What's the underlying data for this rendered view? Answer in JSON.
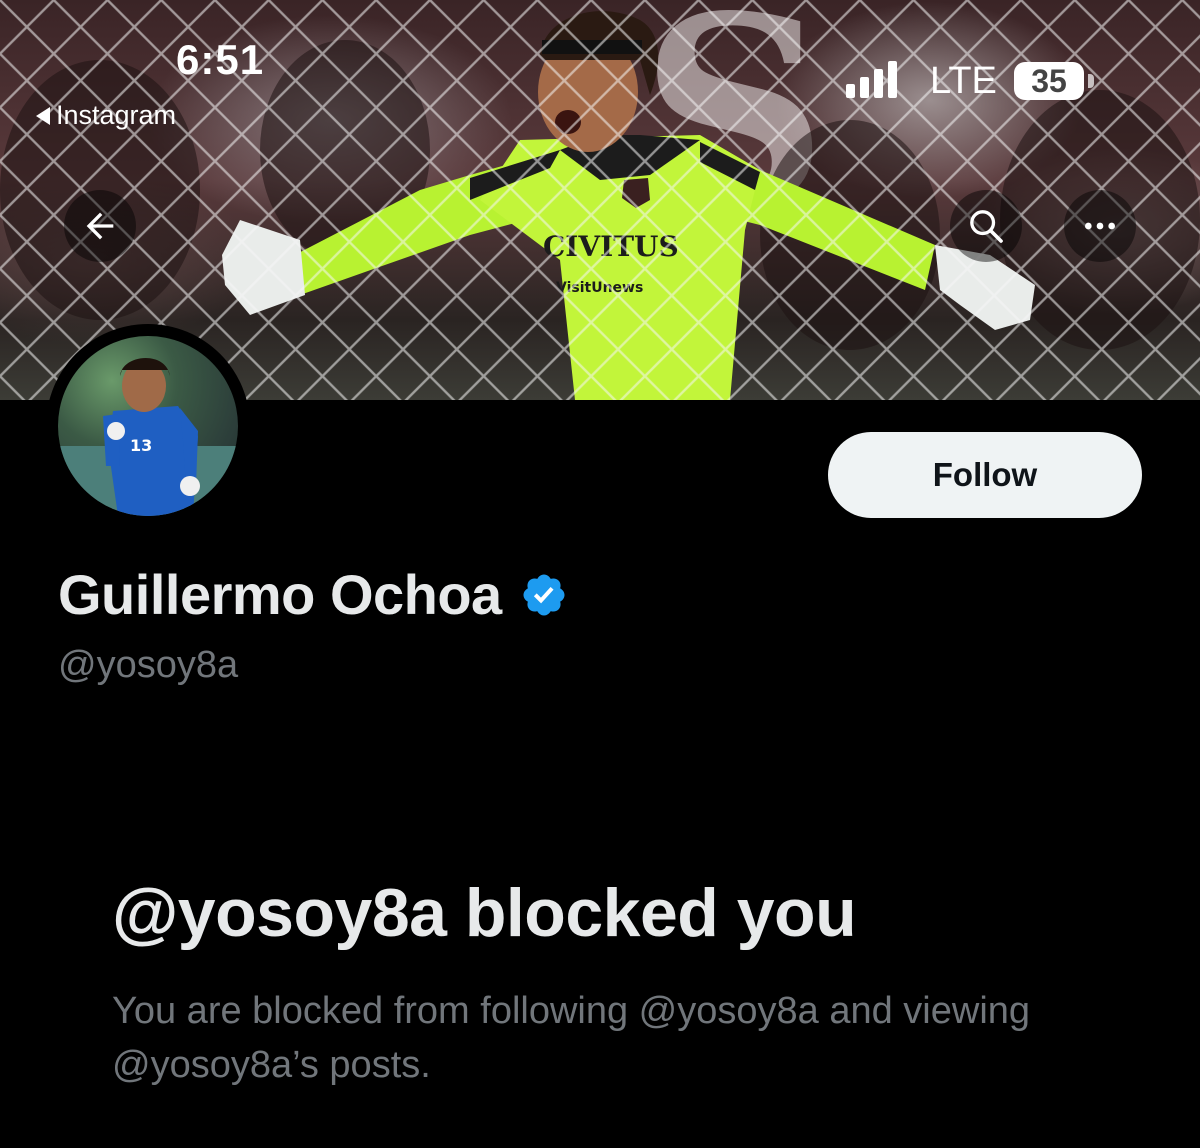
{
  "status_bar": {
    "time": "6:51",
    "back_app": "Instagram",
    "network": "LTE",
    "battery": "35"
  },
  "header": {
    "back_icon": "arrow-left-icon",
    "search_icon": "search-icon",
    "more_icon": "more-horizontal-icon"
  },
  "profile": {
    "name": "Guillermo Ochoa",
    "handle": "@yosoy8a",
    "verified": true,
    "verified_color": "#1d9bf0",
    "follow_label": "Follow"
  },
  "blocked": {
    "title": "@yosoy8a blocked you",
    "description": "You are blocked from following @yosoy8a and viewing @yosoy8a’s posts."
  },
  "colors": {
    "background": "#000000",
    "primary_text": "#e7e9ea",
    "secondary_text": "#71767b",
    "follow_bg": "#eff3f4"
  }
}
